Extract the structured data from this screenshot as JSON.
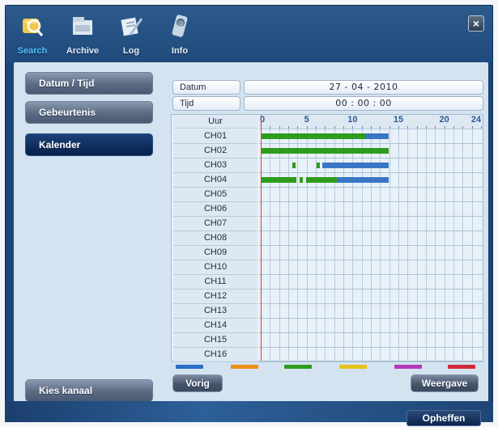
{
  "nav": {
    "items": [
      {
        "label": "Search",
        "icon": "search-icon",
        "active": true
      },
      {
        "label": "Archive",
        "icon": "archive-icon",
        "active": false
      },
      {
        "label": "Log",
        "icon": "log-icon",
        "active": false
      },
      {
        "label": "Info",
        "icon": "info-icon",
        "active": false
      }
    ],
    "close_label": "×"
  },
  "sidebar": {
    "items": [
      {
        "label": "Datum / Tijd",
        "active": false
      },
      {
        "label": "Gebeurtenis",
        "active": false
      },
      {
        "label": "Kalender",
        "active": true
      }
    ],
    "bottom_label": "Kies kanaal"
  },
  "fields": {
    "date_label": "Datum",
    "date_value": "27 - 04 - 2010",
    "time_label": "Tijd",
    "time_value": "00 : 00 : 00"
  },
  "timeline": {
    "hour_header": "Uur",
    "hour_ticks": [
      "0",
      "5",
      "10",
      "15",
      "20",
      "24"
    ],
    "tick_hours": [
      0,
      5,
      10,
      15,
      20,
      24
    ],
    "max_hour": 24,
    "channels": [
      {
        "name": "CH01",
        "recordings": [
          {
            "start": 0,
            "end": 11.5,
            "color": "#2e9c1c"
          },
          {
            "start": 11.5,
            "end": 13.9,
            "color": "#3a76c4"
          }
        ]
      },
      {
        "name": "CH02",
        "recordings": [
          {
            "start": 0,
            "end": 13.9,
            "color": "#2e9c1c"
          }
        ]
      },
      {
        "name": "CH03",
        "recordings": [
          {
            "start": 3.4,
            "end": 3.8,
            "color": "#2e9c1c"
          },
          {
            "start": 6.1,
            "end": 6.4,
            "color": "#2e9c1c"
          },
          {
            "start": 6.7,
            "end": 13.9,
            "color": "#3a76c4"
          }
        ]
      },
      {
        "name": "CH04",
        "recordings": [
          {
            "start": 0,
            "end": 3.9,
            "color": "#2e9c1c"
          },
          {
            "start": 4.2,
            "end": 4.6,
            "color": "#2e9c1c"
          },
          {
            "start": 4.9,
            "end": 8.3,
            "color": "#2e9c1c"
          },
          {
            "start": 8.3,
            "end": 13.9,
            "color": "#3a76c4"
          }
        ]
      },
      {
        "name": "CH05",
        "recordings": []
      },
      {
        "name": "CH06",
        "recordings": []
      },
      {
        "name": "CH07",
        "recordings": []
      },
      {
        "name": "CH08",
        "recordings": []
      },
      {
        "name": "CH09",
        "recordings": []
      },
      {
        "name": "CH10",
        "recordings": []
      },
      {
        "name": "CH11",
        "recordings": []
      },
      {
        "name": "CH12",
        "recordings": []
      },
      {
        "name": "CH13",
        "recordings": []
      },
      {
        "name": "CH14",
        "recordings": []
      },
      {
        "name": "CH15",
        "recordings": []
      },
      {
        "name": "CH16",
        "recordings": []
      }
    ]
  },
  "legend_colors": [
    "#2a6fc9",
    "#f0901c",
    "#2e9c1c",
    "#e6c21a",
    "#b43ab9",
    "#d22a3a"
  ],
  "buttons": {
    "prev": "Vorig",
    "playback": "Weergave",
    "cancel": "Opheffen"
  }
}
